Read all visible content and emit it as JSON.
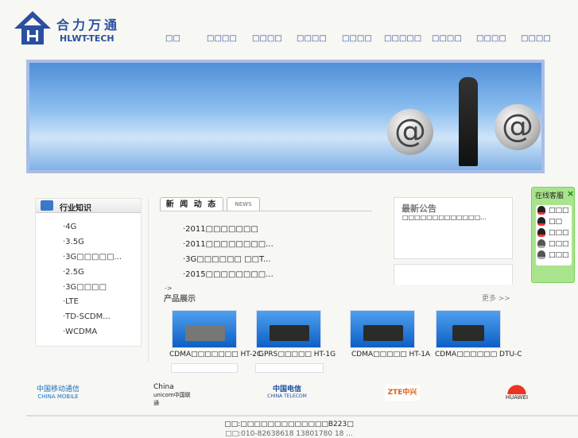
{
  "header": {
    "brand_cn": "合力万通",
    "brand_en": "HLWT-TECH",
    "nav": [
      "□□",
      "□□□□",
      "□□□□",
      "□□□□",
      "□□□□",
      "□□□□□",
      "□□□□",
      "□□□□",
      "□□□□"
    ]
  },
  "sidebar": {
    "title": "行业知识",
    "items": [
      "·4G",
      "·3.5G",
      "·3G□□□□□...",
      "·2.5G",
      "·3G□□□□",
      "·LTE",
      "·TD-SCDM...",
      "·WCDMA"
    ]
  },
  "news": {
    "tab_active": "新 闻 动 态",
    "tab_news": "NEWS",
    "items": [
      "·2011□□□□□□□",
      "·2011□□□□□□□□...",
      "·3G□□□□□□ □□T...",
      "·2015□□□□□□□□..."
    ]
  },
  "products": {
    "arrow": "->",
    "title": "产品展示",
    "more": "更多 >>",
    "items": [
      {
        "caption": "CDMA□□□□□□□ HT-2C"
      },
      {
        "caption": "GPRS□□□□□ HT-1G"
      },
      {
        "caption": "CDMA□□□□□ HT-1A"
      },
      {
        "caption": "CDMA□□□□□□ DTU-C"
      }
    ]
  },
  "notice": {
    "title": "最新公告",
    "text": "□□□□□□□□□□□□□..."
  },
  "service": {
    "title": "在线客服",
    "close": "×",
    "agents": [
      {
        "name": "□□□",
        "online": true
      },
      {
        "name": "□□",
        "online": true
      },
      {
        "name": "□□□",
        "online": true
      },
      {
        "name": "□□□",
        "online": false
      },
      {
        "name": "□□□",
        "online": false
      }
    ]
  },
  "partners": [
    {
      "line1": "中国移动通信",
      "line2": "CHINA MOBILE",
      "color": "#1a6fc0"
    },
    {
      "line1": "China",
      "line2": "unicom中国联通",
      "color": "#222"
    },
    {
      "line1": "中国电信",
      "line2": "CHINA TELECOM",
      "color": "#1a4fa0"
    },
    {
      "line1": "ZTE中兴",
      "line2": "",
      "color": "#e06010"
    },
    {
      "line1": "",
      "line2": "HUAWEI",
      "color": "#d02020"
    }
  ],
  "footer": {
    "address": "□□:□□□□□□□□□□□□□B223□",
    "contact": "□□:010-82638618 13801780 18 ..."
  }
}
